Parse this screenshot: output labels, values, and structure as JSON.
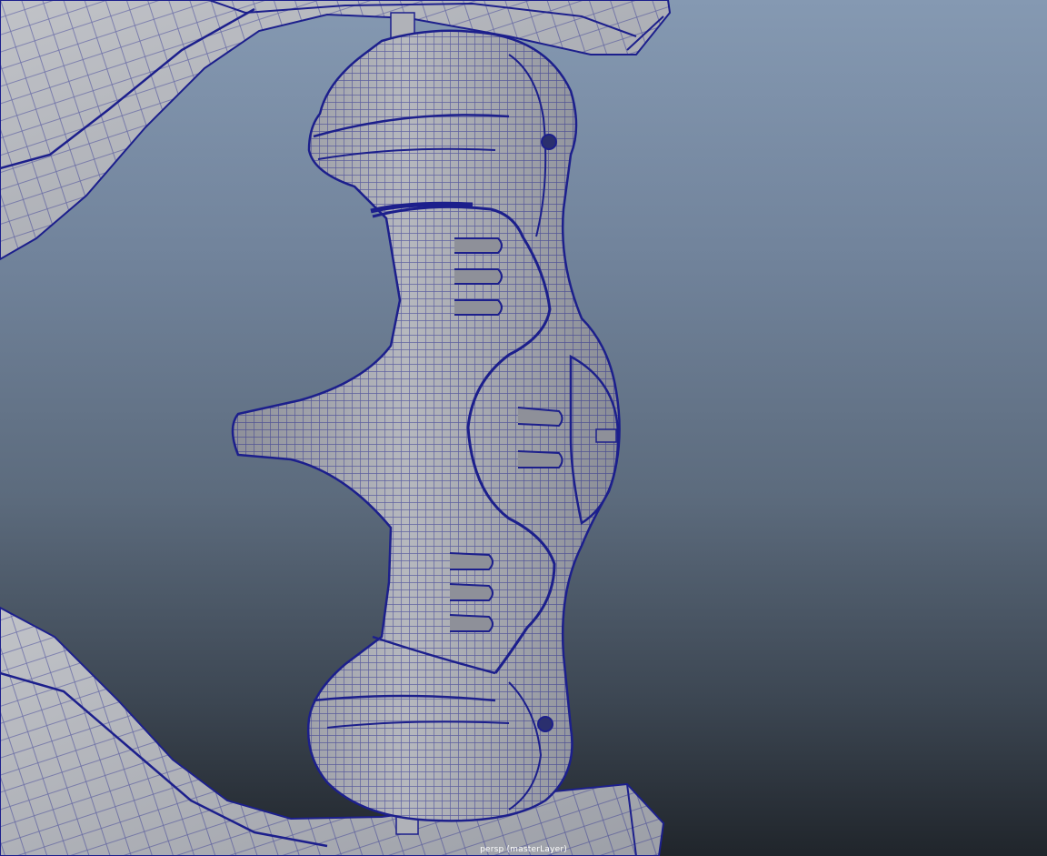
{
  "viewport": {
    "camera_label": "persp (masterLayer)",
    "colors": {
      "background_top": "#8599b2",
      "background_bottom": "#20252b",
      "mesh_fill": "#a9abb2",
      "mesh_shade": "#6f737d",
      "wireframe": "#1c1f8c"
    },
    "objects": [
      {
        "name": "upper-limb-mesh"
      },
      {
        "name": "lower-limb-mesh"
      },
      {
        "name": "riser-handle-mesh"
      }
    ]
  }
}
